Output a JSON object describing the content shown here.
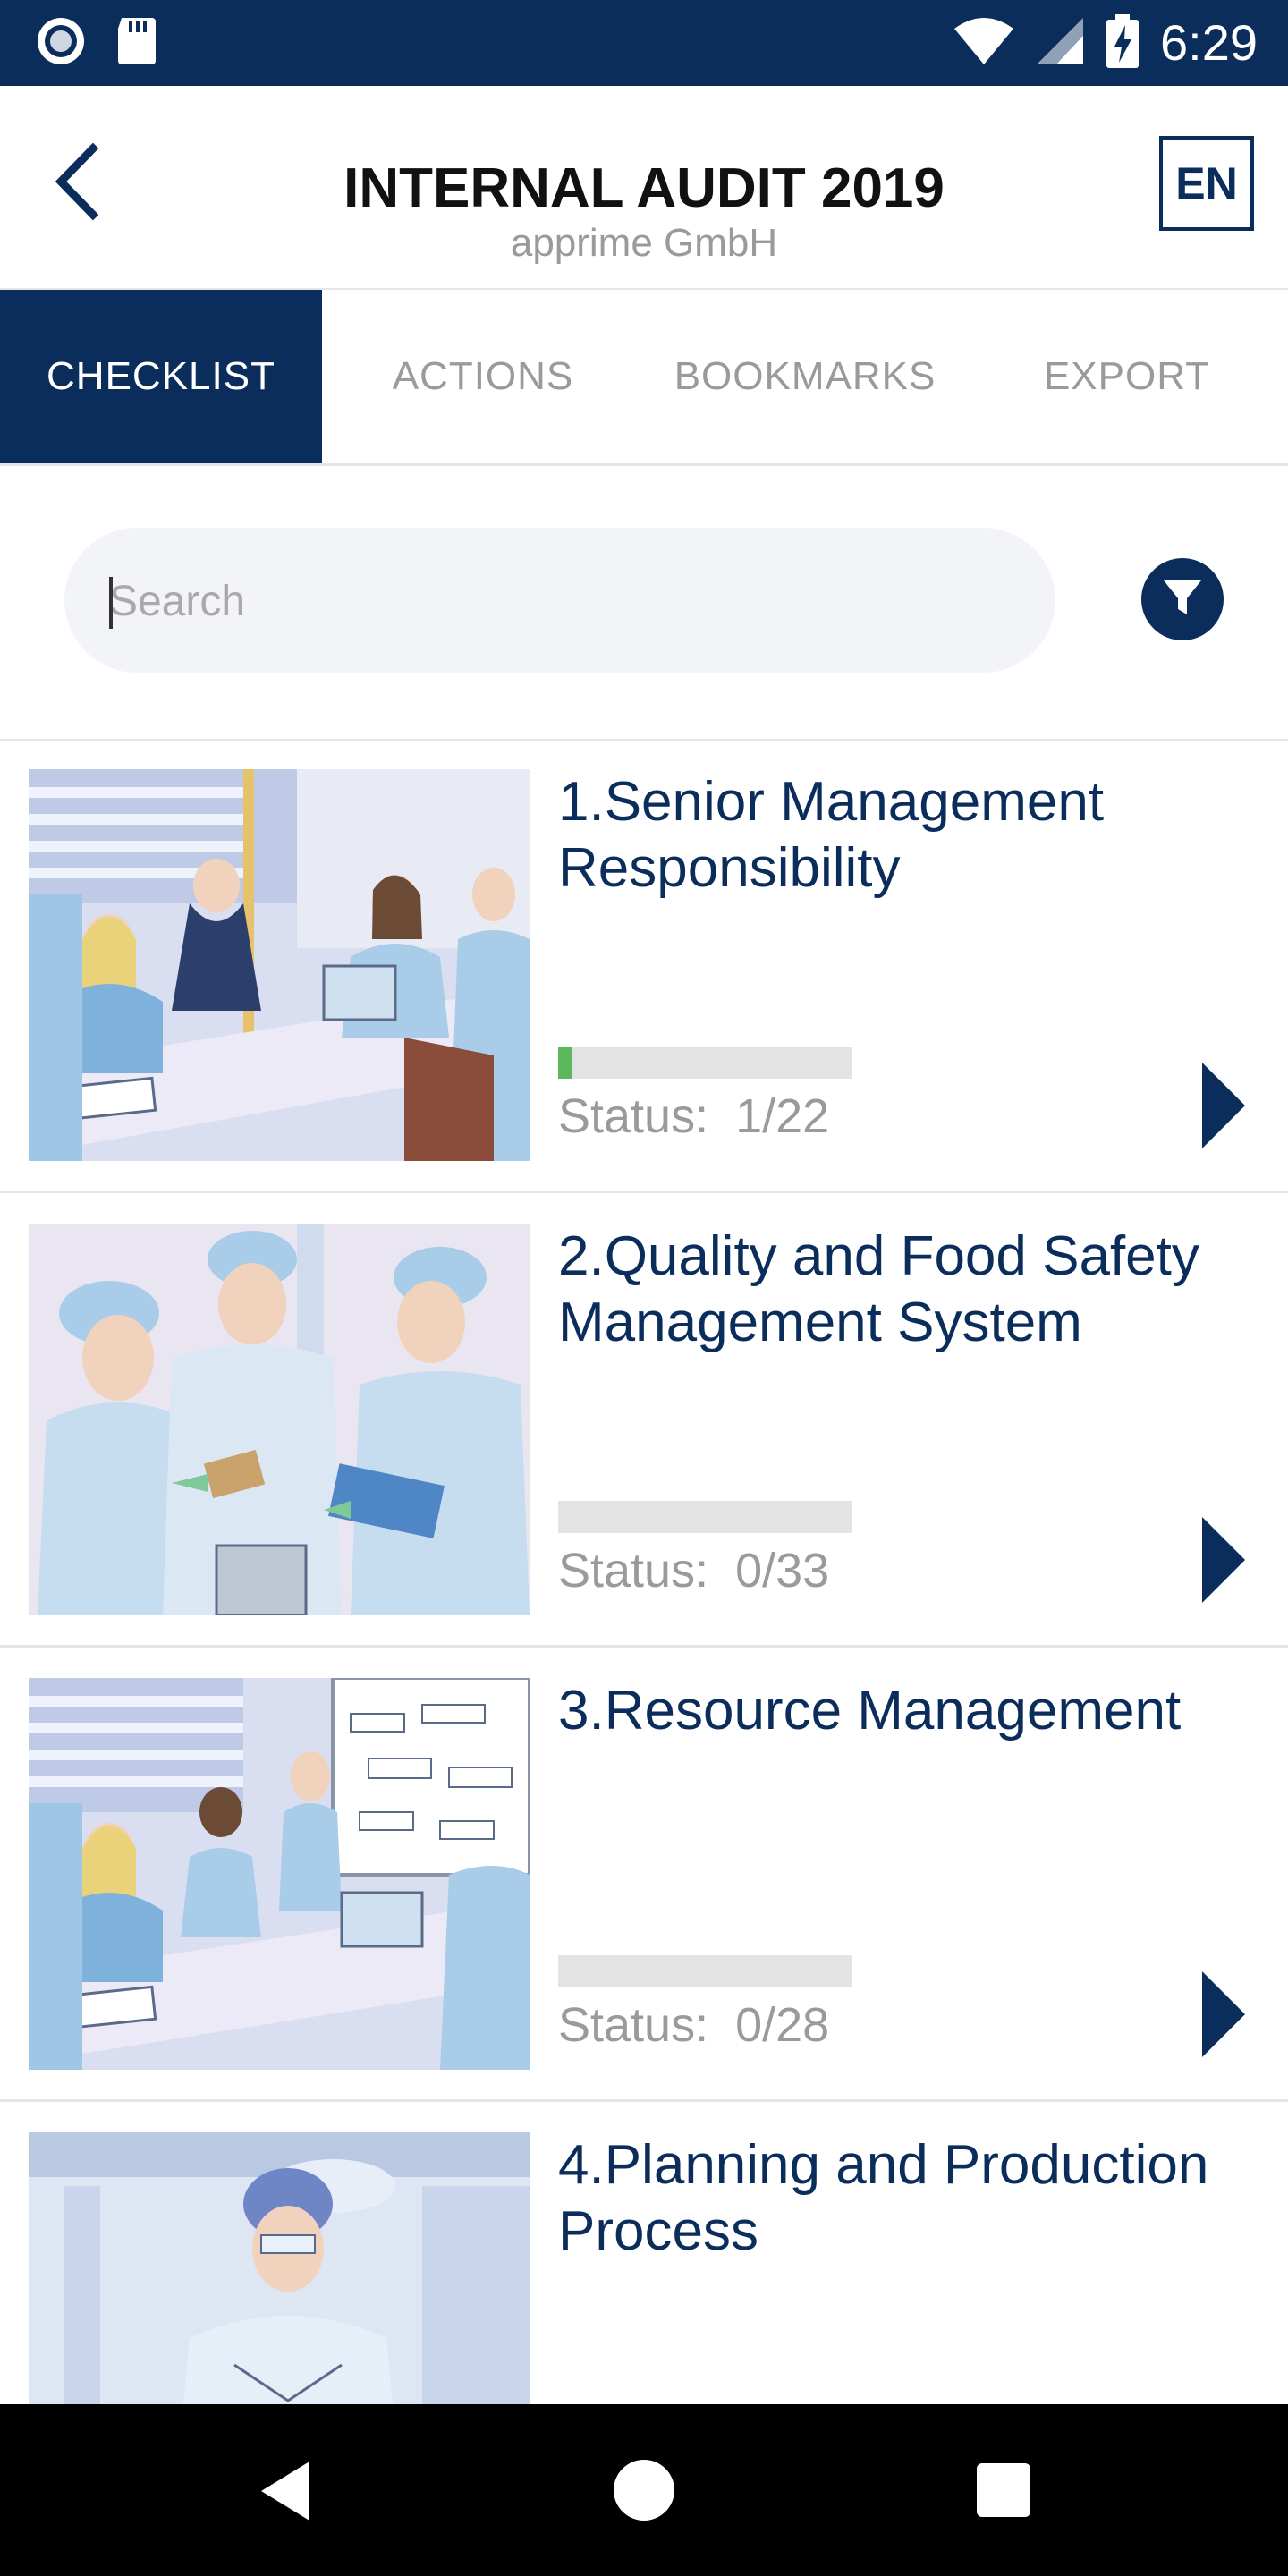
{
  "status_bar": {
    "time": "6:29",
    "icons": [
      "record-icon",
      "sd-card-icon",
      "wifi-icon",
      "signal-icon",
      "battery-icon"
    ]
  },
  "app_bar": {
    "title": "INTERNAL AUDIT 2019",
    "subtitle": "apprime GmbH",
    "language": "EN"
  },
  "tabs": [
    {
      "label": "CHECKLIST",
      "active": true
    },
    {
      "label": "ACTIONS",
      "active": false
    },
    {
      "label": "BOOKMARKS",
      "active": false
    },
    {
      "label": "EXPORT",
      "active": false
    }
  ],
  "search": {
    "placeholder": "Search",
    "value": ""
  },
  "items": [
    {
      "title": "1.Senior Management Responsibility",
      "status_label": "Status:",
      "status_value": "1/22",
      "progress": 0.045
    },
    {
      "title": "2.Quality and Food Safety Management System",
      "status_label": "Status:",
      "status_value": "0/33",
      "progress": 0
    },
    {
      "title": "3.Resource Management",
      "status_label": "Status:",
      "status_value": "0/28",
      "progress": 0
    },
    {
      "title": "4.Planning and Production Process",
      "status_label": "",
      "status_value": "",
      "progress": null
    }
  ],
  "colors": {
    "primary": "#0b2d5c",
    "progress": "#5cb85c",
    "muted": "#9a9a9a"
  }
}
